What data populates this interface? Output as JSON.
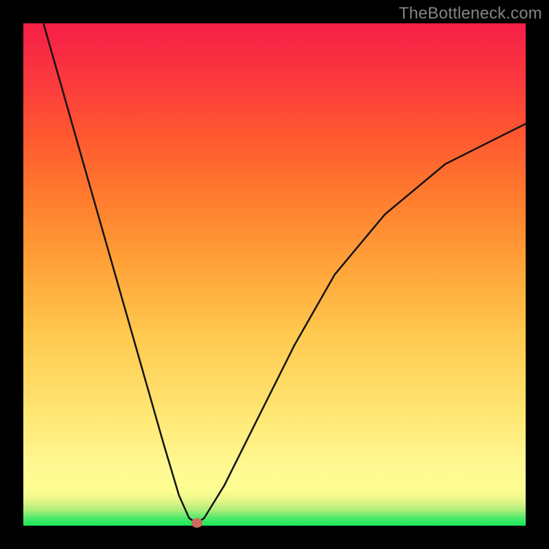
{
  "watermark": "TheBottleneck.com",
  "colors": {
    "frame": "#000000",
    "gradient_top": "#f71f48",
    "gradient_bottom": "#18e858",
    "curve_stroke": "#141414",
    "marker_fill": "#cc6b5f"
  },
  "chart_data": {
    "type": "line",
    "title": "",
    "xlabel": "",
    "ylabel": "",
    "xlim": [
      0,
      100
    ],
    "ylim": [
      0,
      100
    ],
    "grid": false,
    "legend": false,
    "series": [
      {
        "name": "bottleneck-curve",
        "x": [
          4,
          8,
          12,
          16,
          20,
          24,
          28,
          31,
          33,
          34.5,
          36,
          40,
          46,
          54,
          62,
          72,
          84,
          96,
          100
        ],
        "y": [
          100,
          86,
          72,
          58,
          44,
          30,
          16,
          6,
          1.5,
          0.5,
          1.5,
          8,
          20,
          36,
          50,
          62,
          72,
          78,
          80
        ]
      }
    ],
    "marker": {
      "x": 34.5,
      "y": 0.5
    },
    "annotations": [],
    "background_encodes": "color gradient from green (low bottleneck) to red (high bottleneck)"
  }
}
